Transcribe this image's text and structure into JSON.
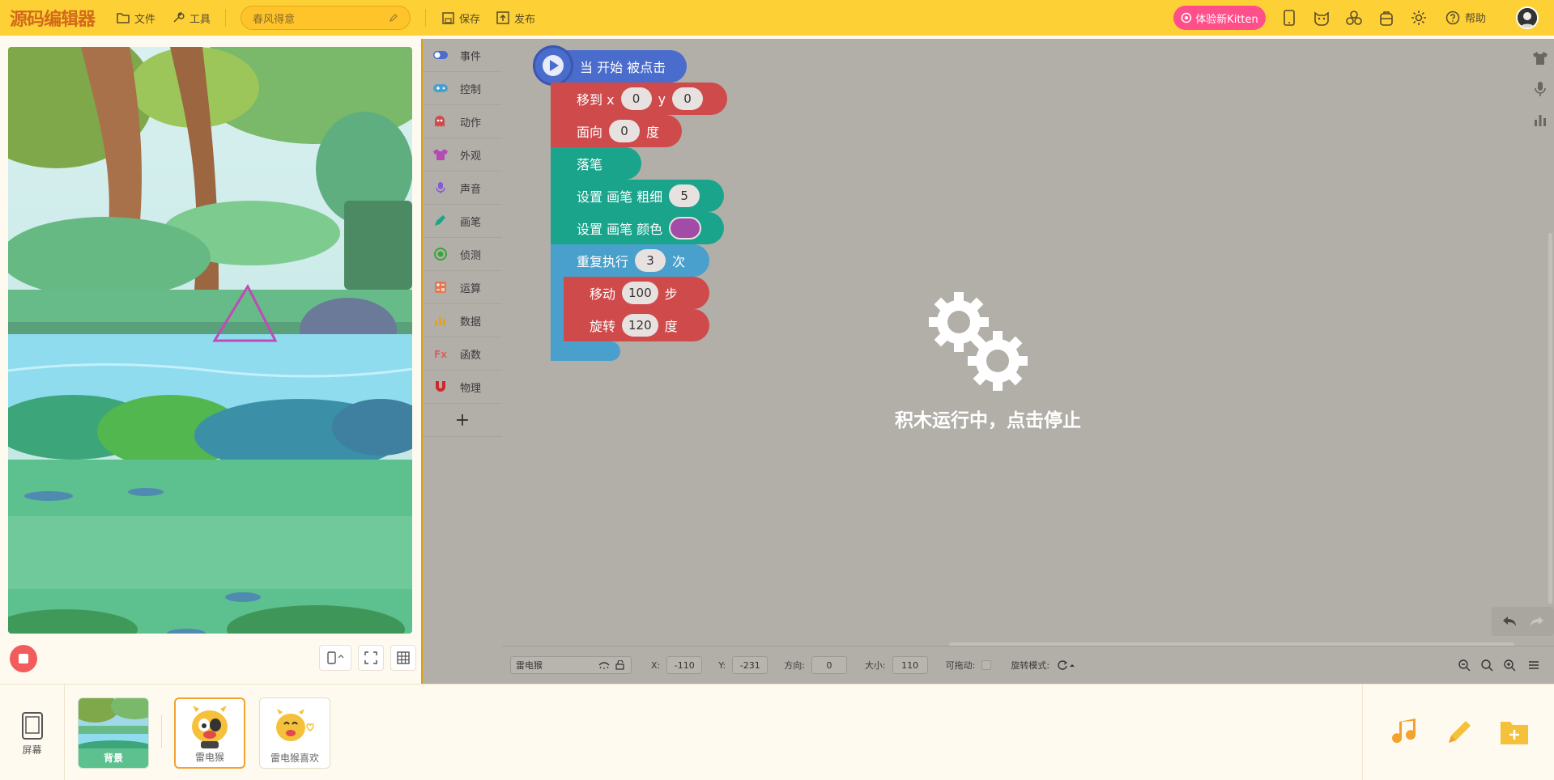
{
  "app": {
    "logo": "源码编辑器",
    "menu_file": "文件",
    "menu_tools": "工具",
    "project_name": "春风得意",
    "save": "保存",
    "publish": "发布",
    "kitten_button": "体验新Kitten",
    "help": "帮助"
  },
  "categories": [
    {
      "label": "事件",
      "icon": "toggle-icon",
      "color": "#4a6ccc"
    },
    {
      "label": "控制",
      "icon": "gamepad-icon",
      "color": "#4aa0cc"
    },
    {
      "label": "动作",
      "icon": "ghost-icon",
      "color": "#cf4a4a"
    },
    {
      "label": "外观",
      "icon": "shirt-icon",
      "color": "#b54ab5"
    },
    {
      "label": "声音",
      "icon": "mic-icon",
      "color": "#8a5ad6"
    },
    {
      "label": "画笔",
      "icon": "pen-icon",
      "color": "#1aa48c"
    },
    {
      "label": "侦测",
      "icon": "target-icon",
      "color": "#3aa53a"
    },
    {
      "label": "运算",
      "icon": "calc-icon",
      "color": "#e07a55"
    },
    {
      "label": "数据",
      "icon": "bar-icon",
      "color": "#e8a020"
    },
    {
      "label": "函数",
      "icon": "function-icon",
      "color": "#e06060"
    },
    {
      "label": "物理",
      "icon": "magnet-icon",
      "color": "#cc2a2a"
    }
  ],
  "blocks": {
    "start": "当 开始 被点击",
    "move_to_label": "移到 x",
    "move_to_y": "y",
    "move_to_x_val": "0",
    "move_to_y_val": "0",
    "face_label": "面向",
    "face_val": "0",
    "face_unit": "度",
    "pen_down": "落笔",
    "set_pen_width": "设置 画笔 粗细",
    "pen_width_val": "5",
    "set_pen_color": "设置 画笔 颜色",
    "pen_color": "#a24ca8",
    "repeat_label": "重复执行",
    "repeat_val": "3",
    "repeat_unit": "次",
    "move_label": "移动",
    "move_val": "100",
    "move_unit": "步",
    "rotate_label": "旋转",
    "rotate_val": "120",
    "rotate_unit": "度"
  },
  "running_overlay": "积木运行中，点击停止",
  "props": {
    "sprite_name": "雷电猴",
    "x_label": "X:",
    "x_val": "-110",
    "y_label": "Y:",
    "y_val": "-231",
    "dir_label": "方向:",
    "dir_val": "0",
    "size_label": "大小:",
    "size_val": "110",
    "drag_label": "可拖动:",
    "rot_label": "旋转模式:"
  },
  "bottom": {
    "screen": "屏幕",
    "sprites": [
      {
        "label": "背景"
      },
      {
        "label": "雷电猴"
      },
      {
        "label": "雷电猴喜欢"
      }
    ]
  }
}
